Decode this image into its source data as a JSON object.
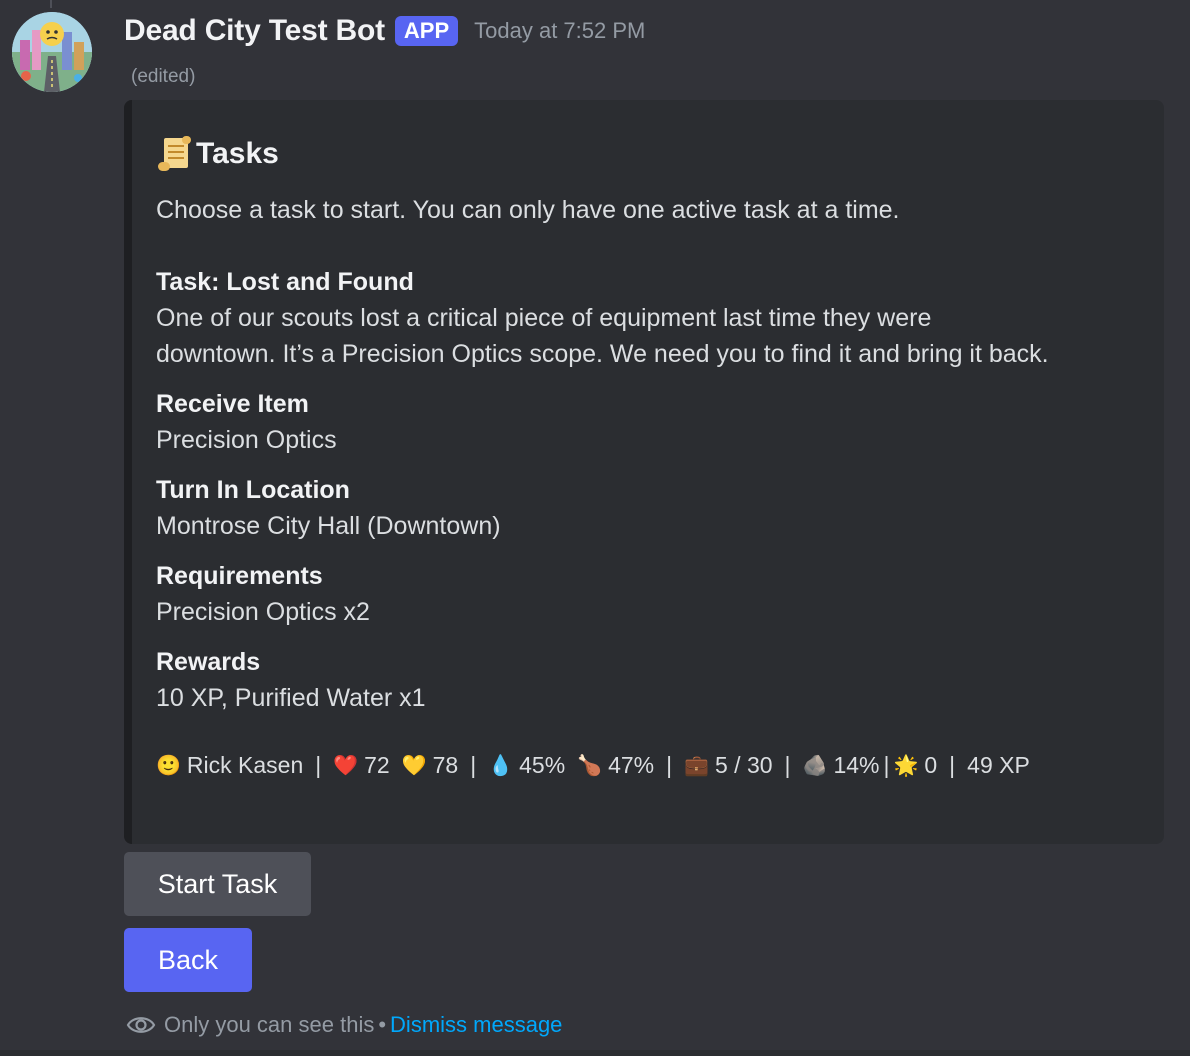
{
  "message": {
    "author": "Dead City Test Bot",
    "badge": "APP",
    "timestamp": "Today at 7:52 PM",
    "edited": "(edited)"
  },
  "embed": {
    "title_icon": "scroll-icon",
    "title": "Tasks",
    "description": "Choose a task to start. You can only have one active task at a time.",
    "task": {
      "title": "Task: Lost and Found",
      "lines": [
        "One of our scouts lost a critical piece of equipment last time they were",
        "downtown. It’s a Precision Optics scope. We need you to find it and bring it back."
      ]
    },
    "fields": [
      {
        "name": "Receive Item",
        "value": "Precision Optics"
      },
      {
        "name": "Turn In Location",
        "value": "Montrose City Hall (Downtown)"
      },
      {
        "name": "Requirements",
        "value": "Precision Optics x2"
      },
      {
        "name": "Rewards",
        "value": "10 XP, Purified Water x1"
      }
    ],
    "stats": {
      "player_icon": "🙂",
      "player": "Rick Kasen",
      "health_icon": "❤️",
      "health": "72",
      "shield_icon": "💛",
      "shield": "78",
      "water_icon": "💧",
      "water": "45%",
      "food_icon": "🍗",
      "food": "47%",
      "bag_icon": "💼",
      "inventory": "5 / 30",
      "rock_icon": "🪨",
      "rock": "14%",
      "star_icon": "🌟",
      "stars": "0",
      "xp": "49 XP",
      "separator": "|"
    }
  },
  "buttons": {
    "start": "Start Task",
    "back": "Back"
  },
  "footer": {
    "visibility_text": "Only you can see this",
    "bullet": "•",
    "dismiss": "Dismiss message"
  },
  "colors": {
    "background": "#323339",
    "embed_bg": "#2b2d31",
    "blurple": "#5865f2",
    "secondary_button": "#4e5058",
    "link": "#00a8fc"
  }
}
